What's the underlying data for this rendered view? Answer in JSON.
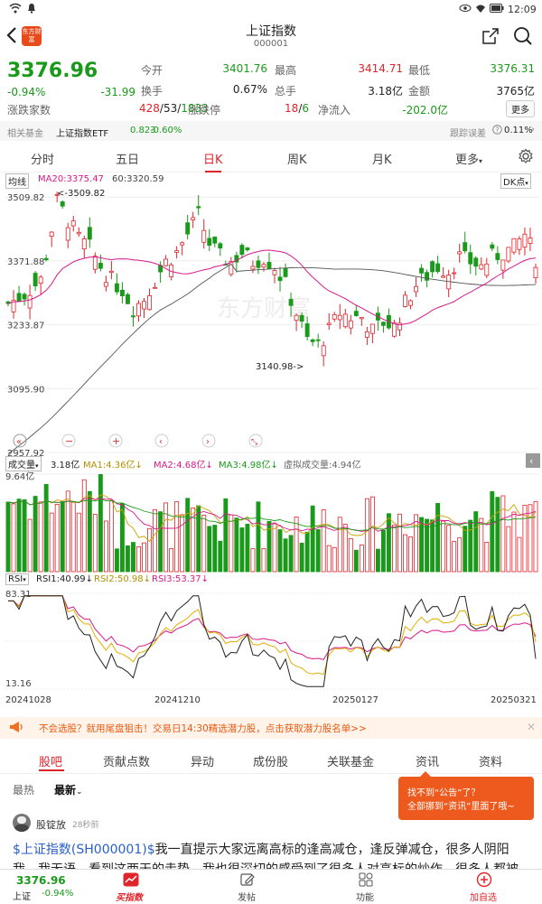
{
  "status": {
    "time": "12:09"
  },
  "header": {
    "title": "上证指数",
    "code": "000001",
    "logo_text": "东方财富"
  },
  "quote": {
    "price": "3376.96",
    "change_pct": "-0.94%",
    "change": "-31.99",
    "rows": [
      [
        {
          "label": "今开",
          "value": "3401.76",
          "color": "green"
        },
        {
          "label": "最高",
          "value": "3414.71",
          "color": "red"
        },
        {
          "label": "最低",
          "value": "3376.31",
          "color": "green"
        }
      ],
      [
        {
          "label": "换手",
          "value": "0.67%",
          "color": "none"
        },
        {
          "label": "总手",
          "value": "3.18亿",
          "color": "none"
        },
        {
          "label": "金额",
          "value": "3765亿",
          "color": "none"
        }
      ]
    ],
    "breadth_label": "涨跌家数",
    "breadth_up": "428",
    "breadth_flat": "53",
    "breadth_down": "1833",
    "limit_label": "涨跌停",
    "limit_up": "18",
    "limit_down": "6",
    "netflow_label": "净流入",
    "netflow": "-202.0亿",
    "more": "更多"
  },
  "related": {
    "label": "相关基金",
    "name": "上证指数ETF",
    "value": "0.823",
    "pct": "-0.60%",
    "track_label": "跟踪误差",
    "track_value": "0.11%"
  },
  "tabs": [
    "分时",
    "五日",
    "日K",
    "周K",
    "月K",
    "更多"
  ],
  "active_tab": 2,
  "kline": {
    "legend_label": "均线",
    "ma20": "MA20:3375.47",
    "ma60": "60:3320.59",
    "dk": "DK点",
    "y_ticks": [
      "3509.82",
      "3371.88",
      "3233.87",
      "3095.90",
      "2957.92"
    ],
    "high_marker": "<-3509.82",
    "low_marker": "3140.98->",
    "watermark": "东方财富"
  },
  "volume": {
    "label": "成交量",
    "value": "3.18亿",
    "ma1": "MA1:4.36亿",
    "ma2": "MA2:4.68亿",
    "ma3": "MA3:4.98亿",
    "virtual": "虚拟成交量:4.94亿",
    "top_tick": "9.64亿"
  },
  "rsi": {
    "label": "RSI",
    "rsi1": "RSI1:40.99",
    "rsi2": "RSI2:50.98",
    "rsi3": "RSI3:53.37",
    "top_tick": "83.31",
    "bottom_tick": "13.16"
  },
  "dates": [
    "20241028",
    "20241210",
    "20250127",
    "20250321"
  ],
  "banner": {
    "text": "不会选股？就用尾盘狙击！交易日14:30精选潜力股，点击获取潜力股名单>>"
  },
  "news_tabs": [
    "股吧",
    "贡献点数",
    "异动",
    "成份股",
    "关联基金",
    "资讯",
    "资料"
  ],
  "sort": {
    "hot": "最热",
    "new": "最新"
  },
  "post": {
    "author": "股锭放",
    "time": "28秒前",
    "link": "$上证指数(SH000001)$",
    "text": "我一直提示大家远离高标的逢高减仓，逢反弹减仓，很多人阴阳我，我无语，看到这两天的走势，我也很深切的感受到了很多人对高标的炒作，很多人都被深套在里面了"
  },
  "tooltip": {
    "line1": "找不到“公告”了？",
    "line2": "全部挪到“资讯”里面了哦~"
  },
  "bottom": {
    "price": "3376.96",
    "name": "上证",
    "pct": "-0.94%",
    "buy": "买指数",
    "post": "发帖",
    "func": "功能",
    "add": "加自选"
  },
  "colors": {
    "up": "#e0242b",
    "down": "#1a9a1a",
    "ma20": "#d61a8a",
    "ma60": "#555555"
  }
}
